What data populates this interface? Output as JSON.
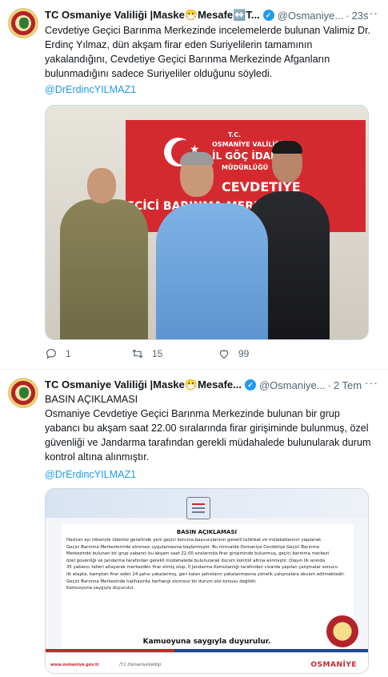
{
  "tweets": [
    {
      "name": "TC Osmaniye Valiliği |Maske😷Mesafe↔️T...",
      "handle": "@Osmaniye...",
      "dot": "·",
      "time": "23s",
      "text": "Cevdetiye Geçici Barınma Merkezinde incelemelerde bulunan Valimiz Dr. Erdinç Yılmaz, dün akşam firar eden Suriyelilerin tamamının yakalandığını, Cevdetiye Geçici Barınma Merkezinde Afganların bulunmadığını sadece Suriyeliler olduğunu söyledi.",
      "mention": "@DrErdincYILMAZ1",
      "photo": {
        "sign_line1": "T.C.",
        "sign_line2": "OSMANİYE VALİLİĞİ",
        "sign_line3": "İL GÖÇ İDARESİ",
        "sign_line4": "MÜDÜRLÜĞÜ",
        "sign_line5": "CEVDETİYE",
        "sign_line6": "GEÇİCİ BARINMA MERKEZİ"
      },
      "actions": {
        "reply": "1",
        "retweet": "15",
        "like": "99"
      }
    },
    {
      "name": "TC Osmaniye Valiliği |Maske😷Mesafe...",
      "handle": "@Osmaniye...",
      "dot": "·",
      "time": "2 Tem",
      "text": "BASIN AÇIKLAMASI\nOsmaniye Cevdetiye  Geçici Barınma Merkezinde bulunan bir grup yabancı bu akşam  saat 22.00 sıralarında firar girişiminde bulunmuş,  özel güvenliği ve Jandarma tarafından  gerekli müdahalede bulunularak durum kontrol altına alınmıştır.",
      "mention": "@DrErdincYILMAZ1",
      "press": {
        "title": "BASIN AÇIKLAMASI",
        "body": "Haziran ayı itibariyle ülkemiz genelinde yeni geçici koruma başvurularının gerekli tahkikat ve mülakatlarının yapılarak\nGeçici Barınma Merkezlerinde alınması uygulamasına  başlanmıştır.   Bu minvalde Osmaniye Cevdetiye  Geçici Barınma\nMerkezinde bulunan bir grup yabancı bu akşam  saat 22.00 sıralarında firar girişiminde bulunmuş,  geçici  barınma merkezi\nözel güvenliği ve Jandarma tarafından  gerekli müdahalede bulunularak durum kontrol altına alınmıştır.  Olayın ilk anında\n35 yabancı telleri atlayarak merkezden firar etmiş olup, İl Jandarma  Komutanlığı tarafından civarda yapılan çalışmalar sonucu\nilk etapta, kamptan firar eden 24 şahıs yakalanmış, geri kalan şahısların yakalanmasına yönelik çalışmalara devam edilmektedir.\nGeçici Barınma Merkezinde halihazırda herhangi olumsuz bir durum söz konusu değildir.\nKamuoyuna saygıyla duyurulur.",
        "tagline": "Kamuoyuna saygıyla duyurulur.",
        "website": "www.osmaniye.gov.tr",
        "social": "/T.C.OsmaniyeValiligi",
        "city": "OSMANİYE"
      }
    }
  ],
  "colors": {
    "link": "#1d9bf0",
    "verified": "#1d9bf0",
    "muted": "#536471",
    "sign_red": "#d42a2f"
  },
  "icons": [
    "verified-badge-icon",
    "more-icon",
    "reply-icon",
    "retweet-icon",
    "like-icon"
  ]
}
